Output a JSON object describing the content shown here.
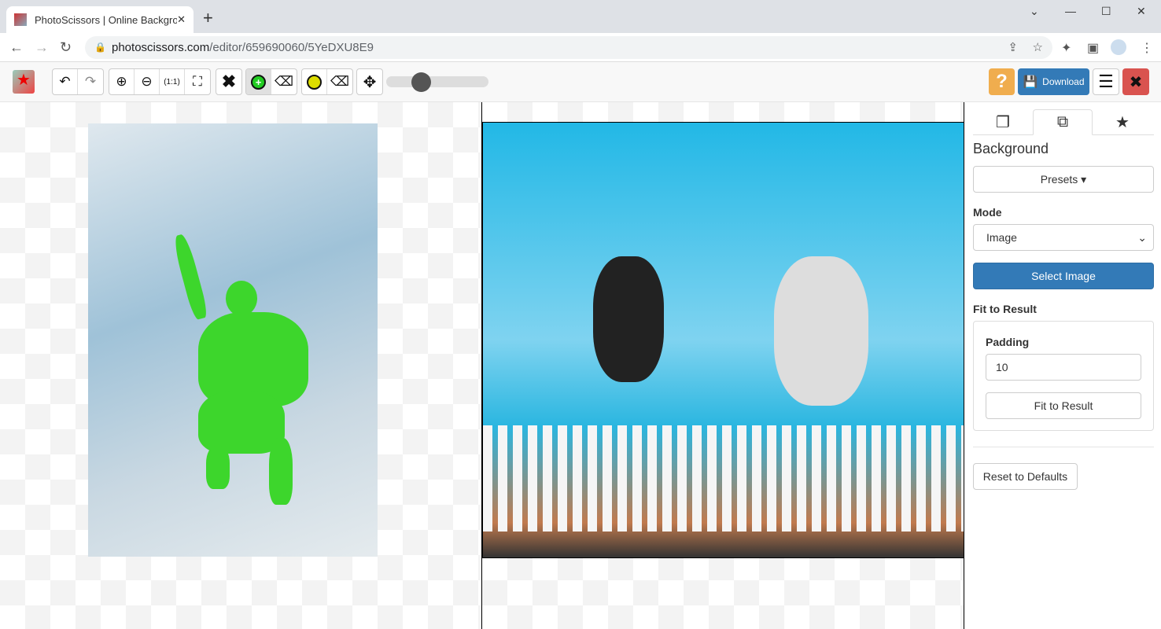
{
  "browser": {
    "tab_title": "PhotoScissors | Online Backgro",
    "url_host": "photoscissors.com",
    "url_path": "/editor/659690060/5YeDXU8E9"
  },
  "toolbar": {
    "tools": [
      "undo-icon",
      "redo-icon",
      "zoom-in-icon",
      "zoom-out-icon",
      "zoom-actual-icon",
      "zoom-fit-icon",
      "clear-icon",
      "foreground-marker-icon",
      "foreground-eraser-icon",
      "background-marker-icon",
      "background-eraser-icon",
      "pan-icon"
    ],
    "brush_size_fraction": 0.3,
    "help_label": "?",
    "download_label": "Download"
  },
  "sidebar": {
    "heading": "Background",
    "presets_label": "Presets ▾",
    "mode_label": "Mode",
    "mode_value": "Image",
    "select_image_label": "Select Image",
    "fit_label": "Fit to Result",
    "padding_label": "Padding",
    "padding_value": "10",
    "fit_button_label": "Fit to Result",
    "reset_label": "Reset to Defaults"
  },
  "colors": {
    "primary": "#337ab7",
    "help": "#f0ad4e",
    "close": "#d9534f",
    "marker": "#3dd62c"
  }
}
